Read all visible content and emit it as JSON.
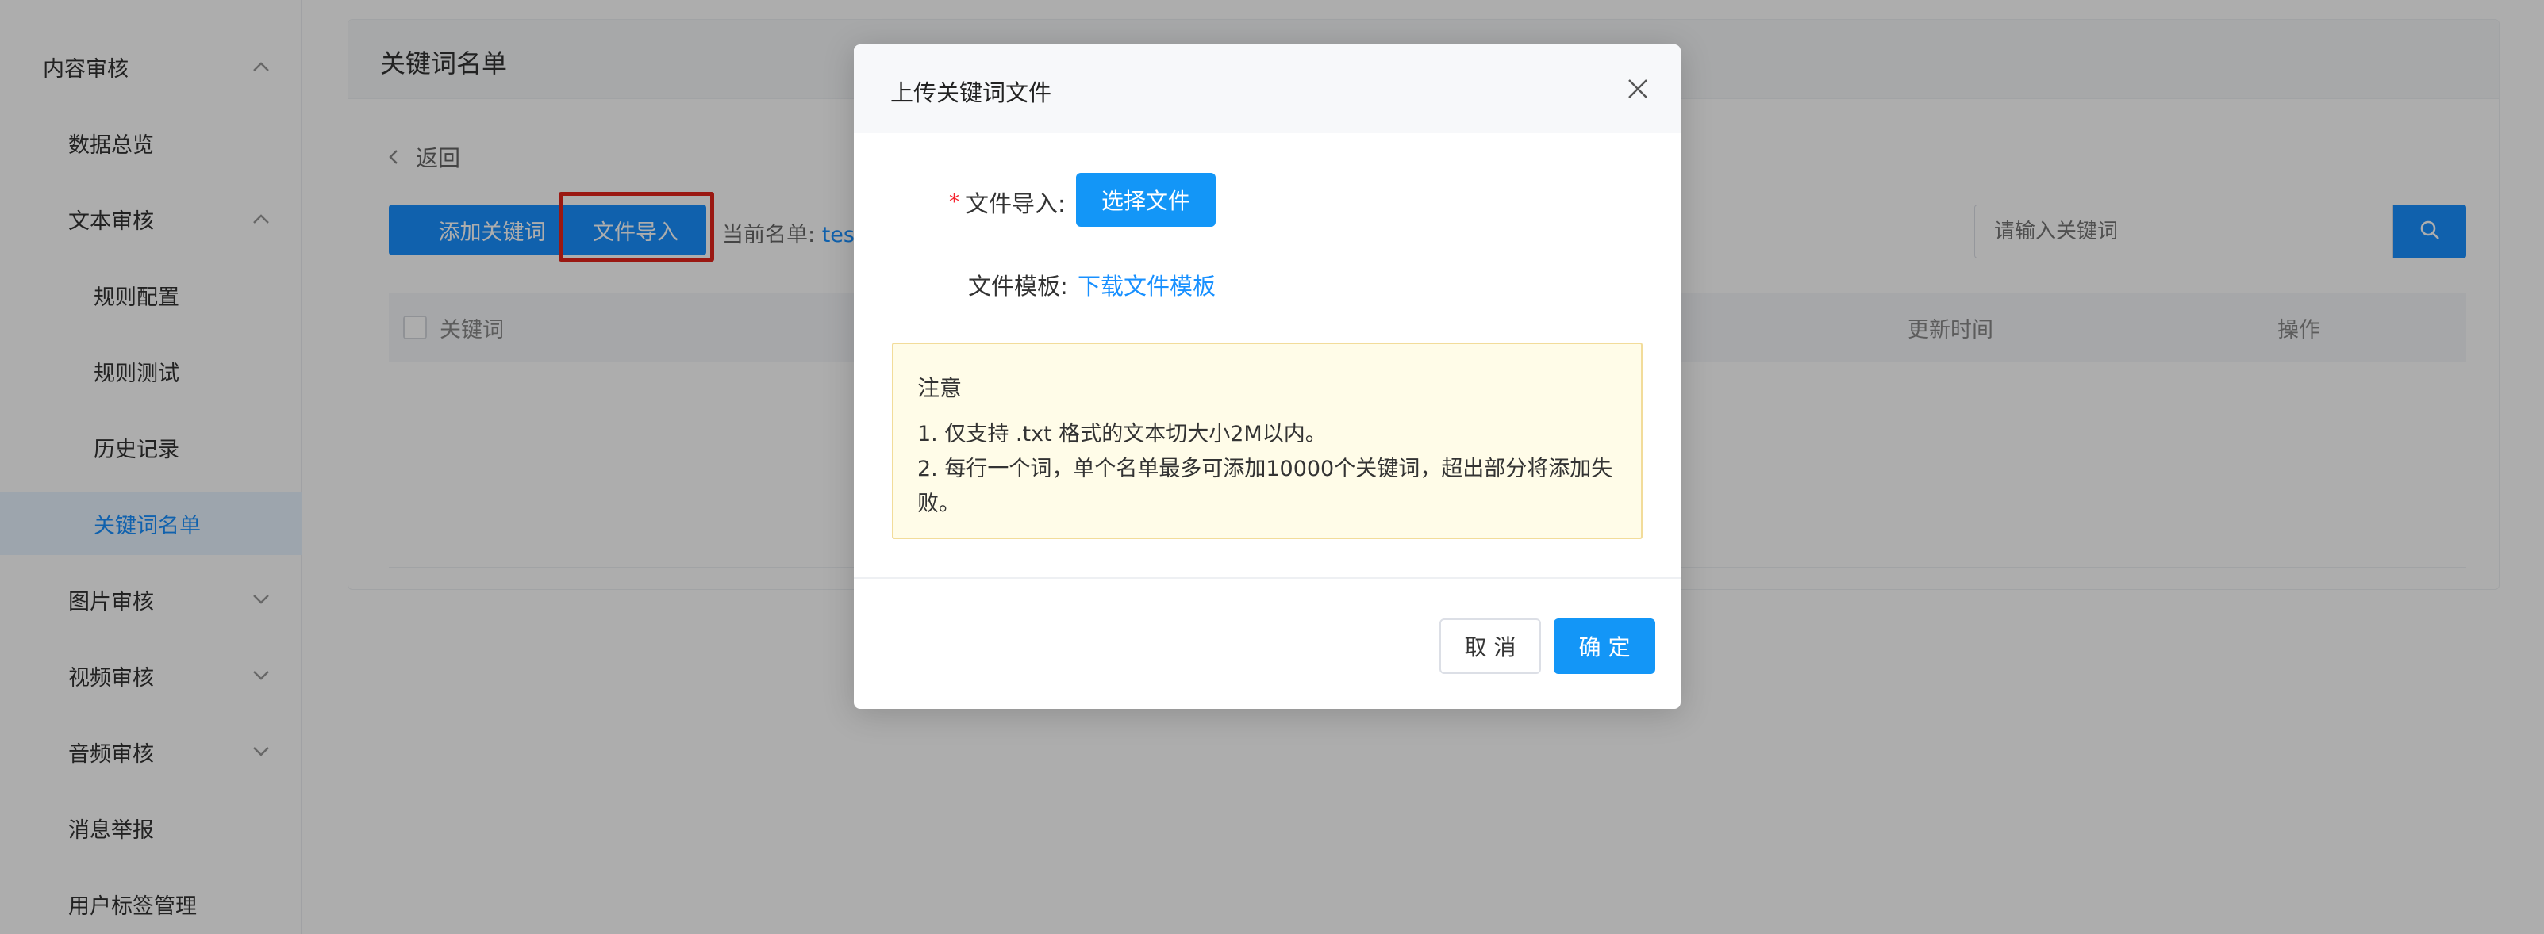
{
  "sidebar": {
    "items": [
      {
        "label": "内容审核",
        "level": 1,
        "expanded": true
      },
      {
        "label": "数据总览",
        "level": 2
      },
      {
        "label": "文本审核",
        "level": 2,
        "expanded": true
      },
      {
        "label": "规则配置",
        "level": 3
      },
      {
        "label": "规则测试",
        "level": 3
      },
      {
        "label": "历史记录",
        "level": 3
      },
      {
        "label": "关键词名单",
        "level": 3,
        "active": true
      },
      {
        "label": "图片审核",
        "level": 2,
        "expanded": false
      },
      {
        "label": "视频审核",
        "level": 2,
        "expanded": false
      },
      {
        "label": "音频审核",
        "level": 2,
        "expanded": false
      },
      {
        "label": "消息举报",
        "level": 2
      },
      {
        "label": "用户标签管理",
        "level": 2
      }
    ]
  },
  "page": {
    "title": "关键词名单",
    "back_label": "返回",
    "add_keyword_label": "添加关键词",
    "import_label": "文件导入",
    "current_list_label": "当前名单:",
    "current_list_value": "tes",
    "search_placeholder": "请输入关键词",
    "columns": [
      "关键词",
      "更新时间",
      "操作"
    ]
  },
  "modal": {
    "title": "上传关键词文件",
    "file_import_label": "文件导入:",
    "choose_file_label": "选择文件",
    "template_label": "文件模板:",
    "download_template_label": "下载文件模板",
    "notice": {
      "title": "注意",
      "line1": "1. 仅支持 .txt 格式的文本切大小2M以内。",
      "line2a": "2. 每行一个词，单个名单最多可添加10000个关键词，超出部分将添加失",
      "line2b": "败。"
    },
    "cancel_label": "取 消",
    "ok_label": "确 定"
  },
  "colors": {
    "primary": "#1890ff",
    "highlight": "#e4241b",
    "notice_bg": "#fffce8",
    "notice_border": "#f2dc9a",
    "required": "#f5222d"
  },
  "icons": {
    "back": "chevron-left-icon",
    "search": "search-icon",
    "close": "close-icon",
    "collapse": "chevron-up-icon",
    "expand": "chevron-down-icon"
  }
}
